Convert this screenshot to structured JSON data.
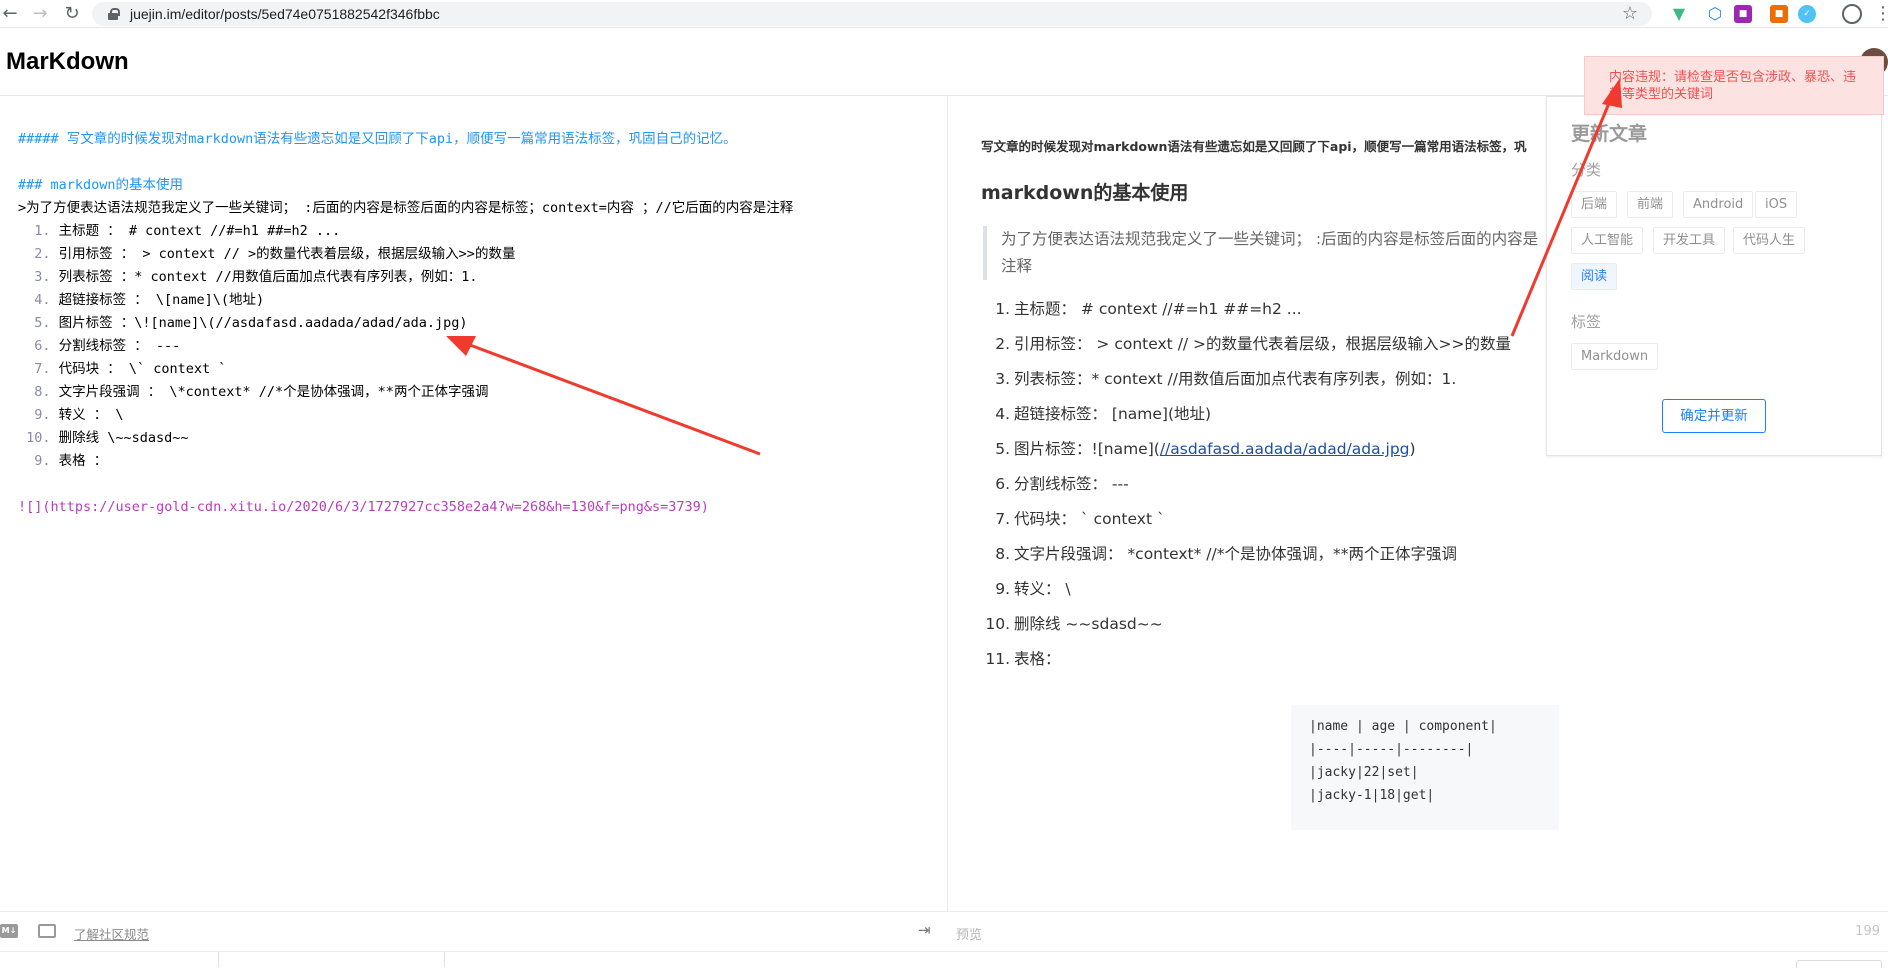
{
  "browser": {
    "url": "juejin.im/editor/posts/5ed74e0751882542f346fbbc"
  },
  "editor": {
    "title": "MarKdown"
  },
  "source": {
    "lines": [
      {
        "num": "",
        "text": "##### 写文章的时候发现对markdown语法有些遗忘如是又回顾了下api，顺便写一篇常用语法标签，巩固自己的记忆。",
        "kind": "head"
      },
      {
        "num": "",
        "text": "",
        "kind": "plain"
      },
      {
        "num": "",
        "text": "### markdown的基本使用",
        "kind": "head"
      },
      {
        "num": "",
        "text": ">为了方便表达语法规范我定义了一些关键词； :后面的内容是标签后面的内容是标签；context=内容 ；//它后面的内容是注释",
        "kind": "plain"
      },
      {
        "num": "1.",
        "text": "主标题 ： # context //#=h1 ##=h2 ...",
        "kind": "plain"
      },
      {
        "num": "2.",
        "text": "引用标签 ： > context // >的数量代表着层级，根据层级输入>>的数量",
        "kind": "plain"
      },
      {
        "num": "3.",
        "text": "列表标签 ：* context //用数值后面加点代表有序列表，例如：1.",
        "kind": "plain"
      },
      {
        "num": "4.",
        "text": "超链接标签 ： \\[name]\\(地址)",
        "kind": "plain"
      },
      {
        "num": "5.",
        "text": "图片标签 ：\\![name]\\(//asdafasd.aadada/adad/ada.jpg)",
        "kind": "plain"
      },
      {
        "num": "6.",
        "text": "分割线标签 ： ---",
        "kind": "plain"
      },
      {
        "num": "7.",
        "text": "代码块 ： \\` context `",
        "kind": "plain"
      },
      {
        "num": "8.",
        "text": "文字片段强调 ： \\*context* //*个是协体强调，**两个正体字强调",
        "kind": "plain"
      },
      {
        "num": "9.",
        "text": "转义 ： \\",
        "kind": "plain"
      },
      {
        "num": "10.",
        "text": "删除线 \\~~sdasd~~",
        "kind": "plain"
      },
      {
        "num": "9.",
        "text": "表格 ：",
        "kind": "plain"
      },
      {
        "num": "",
        "text": "",
        "kind": "plain"
      },
      {
        "num": "",
        "text": "![](https://user-gold-cdn.xitu.io/2020/6/3/1727927cc358e2a4?w=268&h=130&f=png&s=3739)",
        "kind": "image"
      }
    ]
  },
  "preview": {
    "intro": "写文章的时候发现对markdown语法有些遗忘如是又回顾了下api，顺便写一篇常用语法标签，巩",
    "heading": "markdown的基本使用",
    "quote": "为了方便表达语法规范我定义了一些关键词； :后面的内容是标签后面的内容是",
    "quote_cont": "注释",
    "items": [
      {
        "num": "1.",
        "text": "主标题： # context //#=h1 ##=h2 ..."
      },
      {
        "num": "2.",
        "text": "引用标签： > context // >的数量代表着层级，根据层级输入>>的数量"
      },
      {
        "num": "3.",
        "text": "列表标签：* context //用数值后面加点代表有序列表，例如：1."
      },
      {
        "num": "4.",
        "text": "超链接标签： [name](地址)"
      },
      {
        "num": "5.",
        "text": "图片标签：![name](",
        "link": "//asdafasd.aadada/adad/ada.jpg",
        "after": ")"
      },
      {
        "num": "6.",
        "text": "分割线标签： ---"
      },
      {
        "num": "7.",
        "text": "代码块： ` context `"
      },
      {
        "num": "8.",
        "text": "文字片段强调： *context* //*个是协体强调，**两个正体字强调"
      },
      {
        "num": "9.",
        "text": "转义： \\"
      },
      {
        "num": "10.",
        "text": "删除线 ~~sdasd~~"
      },
      {
        "num": "11.",
        "text": "表格："
      }
    ],
    "code_lines": [
      "|name | age | component|",
      "|----|-----|--------|",
      "|jacky|22|set|",
      "|jacky-1|18|get|"
    ]
  },
  "popup": {
    "title": "更新文章",
    "category_label": "分类",
    "categories": [
      "后端",
      "前端",
      "Android",
      "iOS",
      "人工智能",
      "开发工具",
      "代码人生",
      "阅读"
    ],
    "selected_category": "阅读",
    "tag_label": "标签",
    "tags": [
      "Markdown"
    ],
    "confirm_label": "确定并更新"
  },
  "toast": {
    "message": "内容违规：请检查是否包含涉政、暴恐、违禁等类型的关键词"
  },
  "footer": {
    "md_icon_text": "M↓",
    "community_link": "了解社区规范",
    "preview_label": "预览",
    "word_count": "199"
  },
  "colors": {
    "accent": "#1e80ff",
    "error": "#f25050",
    "annotation_arrow": "#f03a2e"
  }
}
